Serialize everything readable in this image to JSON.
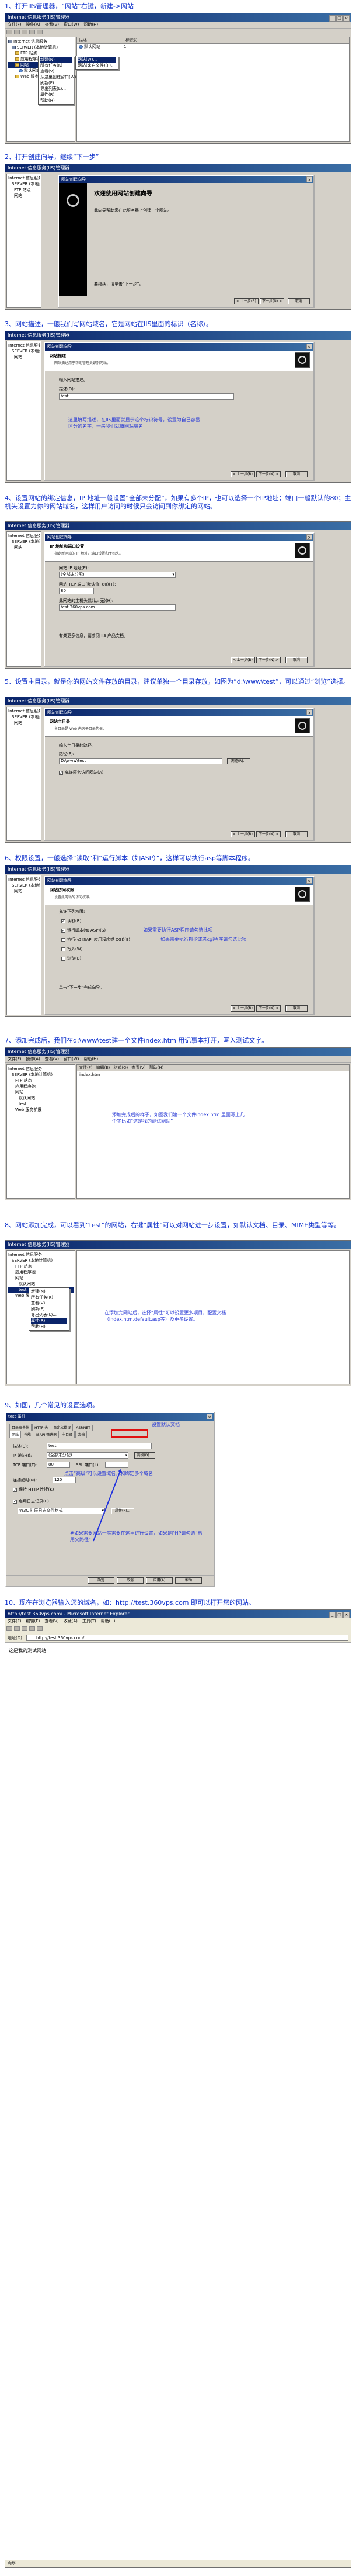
{
  "captions": {
    "s1": "1、打开IIS管理器，“网站”右键，新建->网站",
    "s2": "2、打开创建向导，继续“下一步”",
    "s3": "3、网站描述，一般我们写网站域名，它是网站在IIS里面的标识（名称）。",
    "s4": "4、设置网站的绑定信息，IP 地址一般设置“全部未分配”，如果有多个IP，也可以选择一个IP地址；端口一般默认的80；主机头设置为你的网站域名，这样用户访问的时候只会访问到你绑定的网站。",
    "s5": "5、设置主目录，就是你的网站文件存放的目录，建议单独一个目录存放，如图为“d:\\www\\test”，可以通过“浏览”选择。",
    "s6": "6、权限设置，一般选择“读取”和“运行脚本（如ASP）”，这样可以执行asp等脚本程序。",
    "s7": "7、添加完成后，我们在d:\\www\\test建一个文件index.htm 用记事本打开，写入测试文字。",
    "s8": "8、网站添加完成，可以看到“test”的网站，右键“属性”可以对网站进一步设置，如默认文档、目录、MIME类型等等。",
    "s9": "9、如图，几个常见的设置选项。",
    "s10": "10、现在在浏览器输入您的域名，如：http://test.360vps.com 即可以打开您的网站。"
  },
  "iis": {
    "window_title": "Internet 信息服务(IIS)管理器",
    "menu": [
      "文件(F)",
      "操作(A)",
      "查看(V)",
      "窗口(W)",
      "帮助(H)"
    ],
    "tree": [
      "Internet 信息服务",
      "SERVER (本地计算机)",
      "FTP 站点",
      "应用程序池",
      "网站",
      "默认网站",
      "Web 服务扩展"
    ],
    "list_header_1": "描述",
    "list_header_2": "标识符",
    "list_row_1": "默认网站",
    "list_row_1_id": "1",
    "ctx_menu": [
      "新建(N)",
      "所有任务(K)",
      "查看(V)",
      "从这里创建窗口(W)",
      "刷新(F)",
      "导出列表(L)...",
      "属性(R)",
      "帮助(H)"
    ],
    "submenu": [
      "网站(W)...",
      "网站(来自文件)(F)..."
    ]
  },
  "wizard": {
    "title": "网站创建向导",
    "welcome_title": "欢迎使用网站创建向导",
    "welcome_body": "此向导帮助您在此服务器上创建一个网站。",
    "welcome_next": "要继续，请单击“下一步”。",
    "back": "< 上一步(B)",
    "next": "下一步(N) >",
    "cancel": "取消",
    "desc_head": "网站描述",
    "desc_sub": "网站描述用于帮助管理员识别网站。",
    "desc_label": "输入网站描述。",
    "desc_field_label": "描述(D):",
    "desc_value": "test",
    "desc_note": "这里填写描述，在IIS里面就显示这个标识符号，设置为自己容易区分的名字，一般我们就填网站域名",
    "bind_head": "IP 地址和端口设置",
    "bind_sub": "指定新网站的 IP 地址，端口设置和主机头。",
    "bind_ip_label": "网站 IP 地址(E):",
    "bind_ip_value": "(全部未分配)",
    "bind_port_label": "网站 TCP 端口(默认值: 80)(T):",
    "bind_port_value": "80",
    "bind_host_label": "此网站的主机头(默认: 无)(H):",
    "bind_host_value": "test.360vps.com",
    "bind_ssl_label": "有关更多信息，请参阅 IIS 产品文档。",
    "path_head": "网站主目录",
    "path_sub": "主目录是 Web 内容子目录的根。",
    "path_label": "输入主目录的路径。",
    "path_field_label": "路径(P):",
    "path_value": "D:\\www\\test",
    "browse": "浏览(R)...",
    "anon_label": "允许匿名访问网站(A)",
    "perm_head": "网站访问权限",
    "perm_sub": "设置此网站的访问权限。",
    "perm_label": "允许下列权限:",
    "perm_items": [
      "读取(R)",
      "运行脚本(如 ASP)(S)",
      "执行(如 ISAPI 应用程序或 CGI)(E)",
      "写入(W)",
      "浏览(B)"
    ],
    "perm_note_1": "如果需要执行ASP程序请勾选此项",
    "perm_note_2": "如果需要执行PHP或者cgi程序请勾选此项",
    "perm_footer": "单击“下一步”完成向导。"
  },
  "notepad": {
    "title": "index.htm - 记事本",
    "menu": [
      "文件(F)",
      "编辑(E)",
      "格式(O)",
      "查看(V)",
      "帮助(H)"
    ],
    "text": "index.htm",
    "note": "添加完成后的样子，如图我们建一个文件index.htm 里面写上几个字比如“这是我的测试网站”"
  },
  "step8": {
    "tree_site": "test",
    "note": "在添加完网站后，选择“属性”可以设置更多项目，配置文档（index.htm,default.asp等）及更多设置。"
  },
  "props": {
    "title": "test 属性",
    "tabs_row1": [
      "目录安全性",
      "HTTP 头",
      "自定义错误",
      "ASP.NET"
    ],
    "tabs_row2": [
      "网站",
      "性能",
      "ISAPI 筛选器",
      "主目录",
      "文档"
    ],
    "note_1": "设置默认文档",
    "note_2": "点击“高级”可以设置域名，和绑定多个域名",
    "note_3": "#如果需要网站一般需要在这里进行设置，如果是PHP请勾选“启用父路径”",
    "desc_label": "描述(S):",
    "desc_value": "test",
    "ip_label": "IP 地址(I):",
    "ip_value": "(全部未分配)",
    "port_label": "TCP 端口(T):",
    "port_value": "80",
    "ssl_label": "SSL 端口(L):",
    "adv_button": "高级(D)...",
    "timeout_label": "连接超时(N):",
    "timeout_value": "120",
    "keepalive": "保持 HTTP 连接(K)",
    "log_label": "启用日志记录(E)",
    "log_format": "W3C 扩展日志文件格式",
    "log_props": "属性(P)...",
    "ok": "确定",
    "cancel": "取消",
    "apply": "应用(A)",
    "help": "帮助"
  },
  "browser": {
    "title": "http://test.360vps.com/ - Microsoft Internet Explorer",
    "menu": [
      "文件(F)",
      "编辑(E)",
      "查看(V)",
      "收藏(A)",
      "工具(T)",
      "帮助(H)"
    ],
    "address_label": "地址(D)",
    "address": "http://test.360vps.com/",
    "content": "这是我的测试网站",
    "status": "完毕"
  }
}
